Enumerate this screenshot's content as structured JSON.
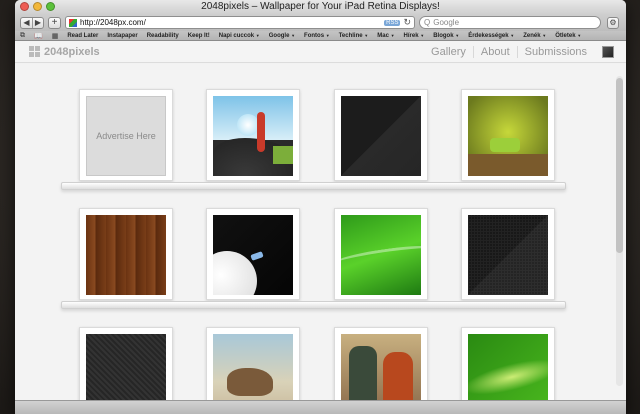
{
  "window": {
    "title": "2048pixels – Wallpaper for Your iPad Retina Displays!"
  },
  "toolbar": {
    "back": "◀",
    "forward": "▶",
    "add": "+",
    "url": "http://2048px.com/",
    "rss": "RSS",
    "reload": "↻",
    "search_placeholder": "Google",
    "search_icon": "Q",
    "gear": "⚙"
  },
  "bookmarks": {
    "icons": [
      "⧉",
      "📖",
      "▦"
    ],
    "items": [
      {
        "label": "Read Later",
        "menu": false
      },
      {
        "label": "Instapaper",
        "menu": false
      },
      {
        "label": "Readability",
        "menu": false
      },
      {
        "label": "Keep It!",
        "menu": false
      },
      {
        "label": "Napi cuccok",
        "menu": true
      },
      {
        "label": "Google",
        "menu": true
      },
      {
        "label": "Fontos",
        "menu": true
      },
      {
        "label": "Techline",
        "menu": true
      },
      {
        "label": "Mac",
        "menu": true
      },
      {
        "label": "Hírek",
        "menu": true
      },
      {
        "label": "Blogok",
        "menu": true
      },
      {
        "label": "Érdekességek",
        "menu": true
      },
      {
        "label": "Zenék",
        "menu": true
      },
      {
        "label": "Ötletek",
        "menu": true
      }
    ],
    "arrow": "▼"
  },
  "site": {
    "logo": "2048pixels",
    "nav": [
      "Gallery",
      "About",
      "Submissions"
    ]
  },
  "gallery": {
    "ad_label": "Advertise Here",
    "tiles": [
      {
        "name": "advertise-tile",
        "kind": "ad"
      },
      {
        "name": "wallpaper-robot-mountain",
        "kind": "robot"
      },
      {
        "name": "wallpaper-dark-diagonal",
        "kind": "darkdiag"
      },
      {
        "name": "wallpaper-green-room",
        "kind": "greenroom"
      },
      {
        "name": "wallpaper-wood-planks",
        "kind": "wood"
      },
      {
        "name": "wallpaper-space-moon",
        "kind": "space"
      },
      {
        "name": "wallpaper-green-wave",
        "kind": "greenwave"
      },
      {
        "name": "wallpaper-dark-mesh",
        "kind": "darkmesh"
      },
      {
        "name": "wallpaper-carbon-diagonal",
        "kind": "carbon"
      },
      {
        "name": "wallpaper-watercolor-horse",
        "kind": "watercolor"
      },
      {
        "name": "wallpaper-painting-figures",
        "kind": "painting"
      },
      {
        "name": "wallpaper-green-sparkle",
        "kind": "sparkle"
      }
    ]
  }
}
